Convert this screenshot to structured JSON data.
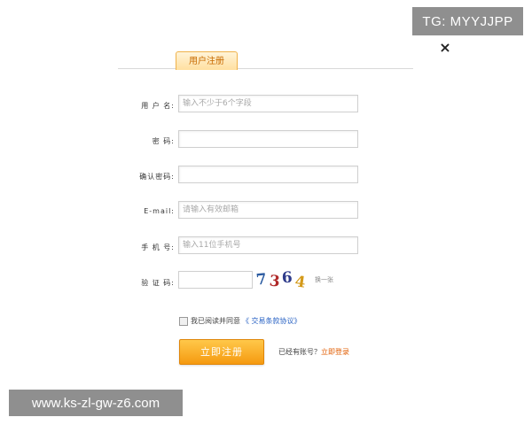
{
  "watermark_top": "TG: MYYJJPP",
  "watermark_bottom": "www.ks-zl-gw-z6.com",
  "close_glyph": "×",
  "tab": {
    "label": "用户注册"
  },
  "form": {
    "username": {
      "label": "用 户 名:",
      "placeholder": "输入不少于6个字段"
    },
    "password": {
      "label": "密    码:",
      "placeholder": ""
    },
    "confirm": {
      "label": "确认密码:",
      "placeholder": ""
    },
    "email": {
      "label": "E-mail:",
      "placeholder": "请输入有效邮箱"
    },
    "phone": {
      "label": "手 机 号:",
      "placeholder": "输入11位手机号"
    },
    "captcha": {
      "label": "验 证 码:",
      "digits": [
        "7",
        "3",
        "6",
        "4"
      ],
      "refresh_label": "换一张"
    }
  },
  "agreement": {
    "text": "我已阅读并同意",
    "link": "《 交易条款协议》"
  },
  "register_button": "立即注册",
  "login_prompt": {
    "text": "已经有账号？",
    "link": "立即登录"
  }
}
